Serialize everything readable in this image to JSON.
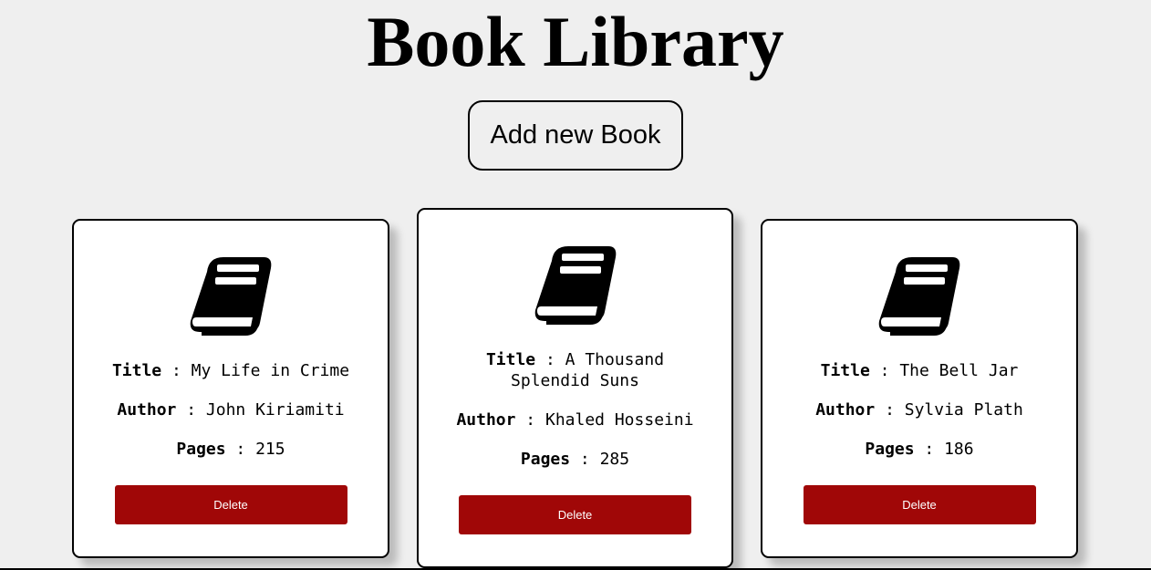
{
  "header": {
    "title": "Book Library",
    "add_button_label": "Add new Book"
  },
  "labels": {
    "title": "Title",
    "author": "Author",
    "pages": "Pages",
    "separator": " : ",
    "delete": "Delete"
  },
  "books": [
    {
      "title": "My Life in Crime",
      "author": "John Kiriamiti",
      "pages": "215"
    },
    {
      "title": "A Thousand Splendid Suns",
      "author": "Khaled Hosseini",
      "pages": "285"
    },
    {
      "title": "The Bell Jar",
      "author": "Sylvia Plath",
      "pages": "186"
    }
  ],
  "icons": {
    "book": "book-icon"
  },
  "colors": {
    "page_background": "#efefef",
    "card_background": "#ffffff",
    "delete_button": "#a00707"
  }
}
